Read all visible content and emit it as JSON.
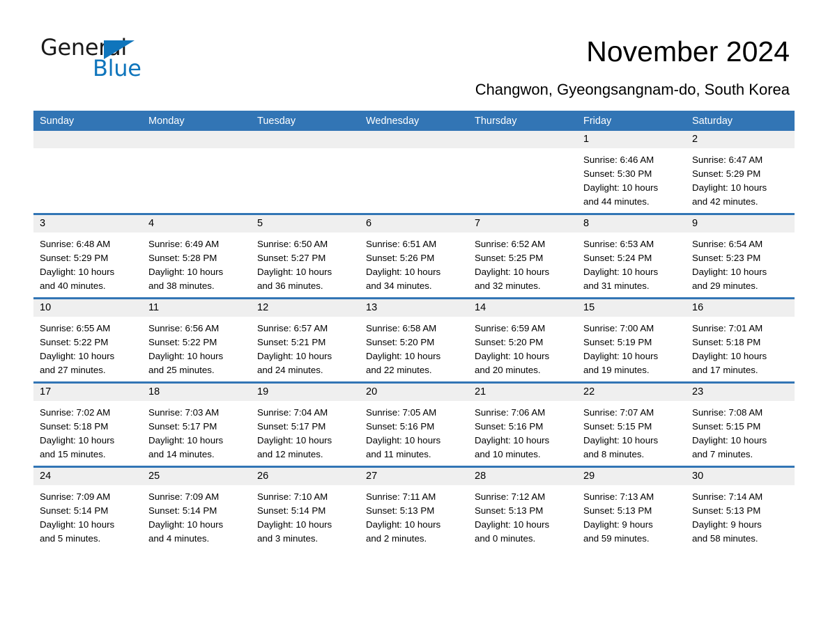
{
  "brand": {
    "name_part1": "General",
    "name_part2": "Blue",
    "triangle_color": "#0f75bc"
  },
  "header": {
    "title": "November 2024",
    "subtitle": "Changwon, Gyeongsangnam-do, South Korea"
  },
  "calendar": {
    "header_bg": "#3275b5",
    "daynum_bg": "#efefef",
    "weekday_headers": [
      "Sunday",
      "Monday",
      "Tuesday",
      "Wednesday",
      "Thursday",
      "Friday",
      "Saturday"
    ],
    "labels": {
      "sunrise": "Sunrise:",
      "sunset": "Sunset:",
      "daylight": "Daylight:"
    },
    "weeks": [
      [
        {
          "day": "",
          "lines": []
        },
        {
          "day": "",
          "lines": []
        },
        {
          "day": "",
          "lines": []
        },
        {
          "day": "",
          "lines": []
        },
        {
          "day": "",
          "lines": []
        },
        {
          "day": "1",
          "lines": [
            "Sunrise: 6:46 AM",
            "Sunset: 5:30 PM",
            "Daylight: 10 hours",
            "and 44 minutes."
          ]
        },
        {
          "day": "2",
          "lines": [
            "Sunrise: 6:47 AM",
            "Sunset: 5:29 PM",
            "Daylight: 10 hours",
            "and 42 minutes."
          ]
        }
      ],
      [
        {
          "day": "3",
          "lines": [
            "Sunrise: 6:48 AM",
            "Sunset: 5:29 PM",
            "Daylight: 10 hours",
            "and 40 minutes."
          ]
        },
        {
          "day": "4",
          "lines": [
            "Sunrise: 6:49 AM",
            "Sunset: 5:28 PM",
            "Daylight: 10 hours",
            "and 38 minutes."
          ]
        },
        {
          "day": "5",
          "lines": [
            "Sunrise: 6:50 AM",
            "Sunset: 5:27 PM",
            "Daylight: 10 hours",
            "and 36 minutes."
          ]
        },
        {
          "day": "6",
          "lines": [
            "Sunrise: 6:51 AM",
            "Sunset: 5:26 PM",
            "Daylight: 10 hours",
            "and 34 minutes."
          ]
        },
        {
          "day": "7",
          "lines": [
            "Sunrise: 6:52 AM",
            "Sunset: 5:25 PM",
            "Daylight: 10 hours",
            "and 32 minutes."
          ]
        },
        {
          "day": "8",
          "lines": [
            "Sunrise: 6:53 AM",
            "Sunset: 5:24 PM",
            "Daylight: 10 hours",
            "and 31 minutes."
          ]
        },
        {
          "day": "9",
          "lines": [
            "Sunrise: 6:54 AM",
            "Sunset: 5:23 PM",
            "Daylight: 10 hours",
            "and 29 minutes."
          ]
        }
      ],
      [
        {
          "day": "10",
          "lines": [
            "Sunrise: 6:55 AM",
            "Sunset: 5:22 PM",
            "Daylight: 10 hours",
            "and 27 minutes."
          ]
        },
        {
          "day": "11",
          "lines": [
            "Sunrise: 6:56 AM",
            "Sunset: 5:22 PM",
            "Daylight: 10 hours",
            "and 25 minutes."
          ]
        },
        {
          "day": "12",
          "lines": [
            "Sunrise: 6:57 AM",
            "Sunset: 5:21 PM",
            "Daylight: 10 hours",
            "and 24 minutes."
          ]
        },
        {
          "day": "13",
          "lines": [
            "Sunrise: 6:58 AM",
            "Sunset: 5:20 PM",
            "Daylight: 10 hours",
            "and 22 minutes."
          ]
        },
        {
          "day": "14",
          "lines": [
            "Sunrise: 6:59 AM",
            "Sunset: 5:20 PM",
            "Daylight: 10 hours",
            "and 20 minutes."
          ]
        },
        {
          "day": "15",
          "lines": [
            "Sunrise: 7:00 AM",
            "Sunset: 5:19 PM",
            "Daylight: 10 hours",
            "and 19 minutes."
          ]
        },
        {
          "day": "16",
          "lines": [
            "Sunrise: 7:01 AM",
            "Sunset: 5:18 PM",
            "Daylight: 10 hours",
            "and 17 minutes."
          ]
        }
      ],
      [
        {
          "day": "17",
          "lines": [
            "Sunrise: 7:02 AM",
            "Sunset: 5:18 PM",
            "Daylight: 10 hours",
            "and 15 minutes."
          ]
        },
        {
          "day": "18",
          "lines": [
            "Sunrise: 7:03 AM",
            "Sunset: 5:17 PM",
            "Daylight: 10 hours",
            "and 14 minutes."
          ]
        },
        {
          "day": "19",
          "lines": [
            "Sunrise: 7:04 AM",
            "Sunset: 5:17 PM",
            "Daylight: 10 hours",
            "and 12 minutes."
          ]
        },
        {
          "day": "20",
          "lines": [
            "Sunrise: 7:05 AM",
            "Sunset: 5:16 PM",
            "Daylight: 10 hours",
            "and 11 minutes."
          ]
        },
        {
          "day": "21",
          "lines": [
            "Sunrise: 7:06 AM",
            "Sunset: 5:16 PM",
            "Daylight: 10 hours",
            "and 10 minutes."
          ]
        },
        {
          "day": "22",
          "lines": [
            "Sunrise: 7:07 AM",
            "Sunset: 5:15 PM",
            "Daylight: 10 hours",
            "and 8 minutes."
          ]
        },
        {
          "day": "23",
          "lines": [
            "Sunrise: 7:08 AM",
            "Sunset: 5:15 PM",
            "Daylight: 10 hours",
            "and 7 minutes."
          ]
        }
      ],
      [
        {
          "day": "24",
          "lines": [
            "Sunrise: 7:09 AM",
            "Sunset: 5:14 PM",
            "Daylight: 10 hours",
            "and 5 minutes."
          ]
        },
        {
          "day": "25",
          "lines": [
            "Sunrise: 7:09 AM",
            "Sunset: 5:14 PM",
            "Daylight: 10 hours",
            "and 4 minutes."
          ]
        },
        {
          "day": "26",
          "lines": [
            "Sunrise: 7:10 AM",
            "Sunset: 5:14 PM",
            "Daylight: 10 hours",
            "and 3 minutes."
          ]
        },
        {
          "day": "27",
          "lines": [
            "Sunrise: 7:11 AM",
            "Sunset: 5:13 PM",
            "Daylight: 10 hours",
            "and 2 minutes."
          ]
        },
        {
          "day": "28",
          "lines": [
            "Sunrise: 7:12 AM",
            "Sunset: 5:13 PM",
            "Daylight: 10 hours",
            "and 0 minutes."
          ]
        },
        {
          "day": "29",
          "lines": [
            "Sunrise: 7:13 AM",
            "Sunset: 5:13 PM",
            "Daylight: 9 hours",
            "and 59 minutes."
          ]
        },
        {
          "day": "30",
          "lines": [
            "Sunrise: 7:14 AM",
            "Sunset: 5:13 PM",
            "Daylight: 9 hours",
            "and 58 minutes."
          ]
        }
      ]
    ]
  }
}
